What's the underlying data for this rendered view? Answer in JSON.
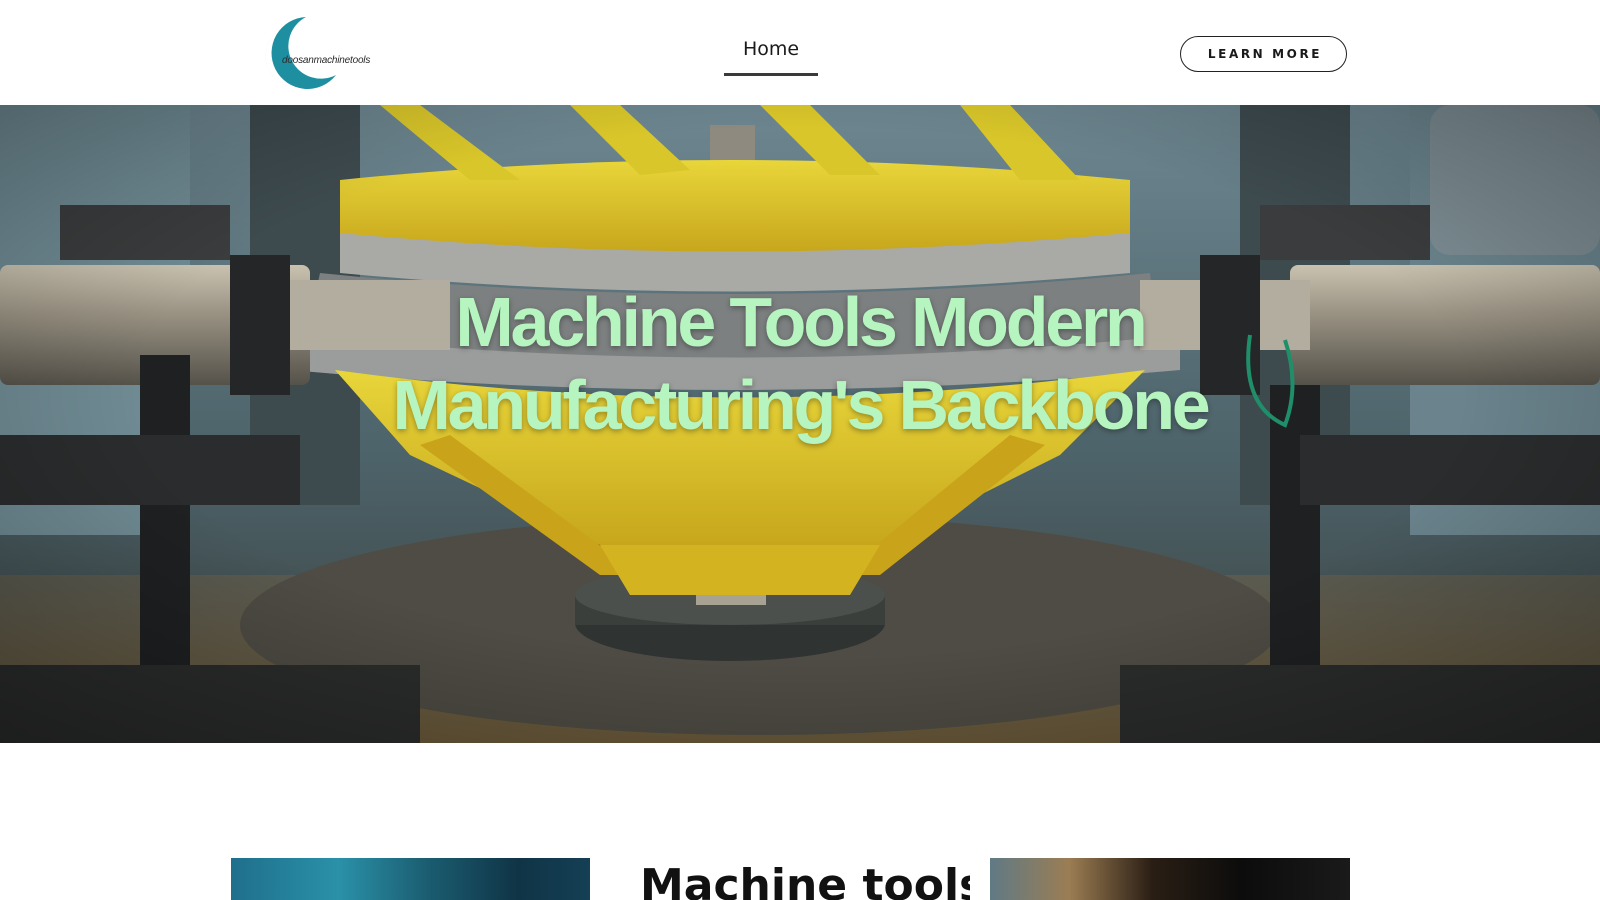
{
  "header": {
    "logo_text": "doosanmachinetools",
    "nav": {
      "home_label": "Home"
    },
    "cta_label": "LEARN MORE"
  },
  "hero": {
    "title_line1": "Machine Tools Modern",
    "title_line2": "Manufacturing's Backbone"
  },
  "content": {
    "section_title": "Machine tools"
  },
  "colors": {
    "hero_title": "#b6f5bf",
    "logo_teal": "#1e8fa0",
    "logo_dark": "#3a4a55"
  }
}
